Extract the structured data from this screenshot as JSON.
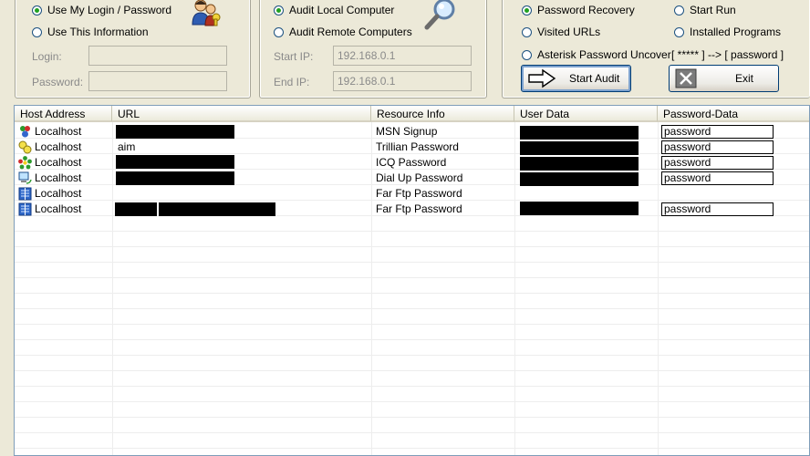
{
  "login_panel": {
    "radio_use_my_login": "Use My Login / Password",
    "radio_use_this_info": "Use This Information",
    "login_label": "Login:",
    "password_label": "Password:",
    "login_value": "",
    "password_value": ""
  },
  "audit_panel": {
    "radio_local": "Audit Local Computer",
    "radio_remote": "Audit Remote Computers",
    "start_ip_label": "Start IP:",
    "end_ip_label": "End IP:",
    "start_ip_value": "192.168.0.1",
    "end_ip_value": "192.168.0.1"
  },
  "options_panel": {
    "radio_password_recovery": "Password Recovery",
    "radio_start_run": "Start Run",
    "radio_visited_urls": "Visited URLs",
    "radio_installed_programs": "Installed Programs",
    "radio_asterisk": "Asterisk Password Uncover",
    "asterisk_hint": "[ ***** ] --> [ password ]",
    "start_audit_label": "Start Audit",
    "exit_label": "Exit"
  },
  "table": {
    "columns": [
      "Host Address",
      "URL",
      "Resource Info",
      "User Data",
      "Password-Data"
    ],
    "rows": [
      {
        "host": "Localhost",
        "url": "",
        "resource": "MSN Signup",
        "password": "password",
        "icon": "msn-people-icon"
      },
      {
        "host": "Localhost",
        "url": "aim",
        "resource": "Trillian Password",
        "password": "password",
        "icon": "trillian-icon"
      },
      {
        "host": "Localhost",
        "url": "",
        "resource": "ICQ Password",
        "password": "password",
        "icon": "icq-flower-icon"
      },
      {
        "host": "Localhost",
        "url": "",
        "resource": "Dial Up Password",
        "password": "password",
        "icon": "dialup-computer-icon"
      },
      {
        "host": "Localhost",
        "url": "",
        "resource": "Far Ftp Password",
        "password": "",
        "icon": "far-ftp-icon"
      },
      {
        "host": "Localhost",
        "url": "",
        "resource": "Far Ftp Password",
        "password": "password",
        "icon": "far-ftp-icon"
      }
    ]
  }
}
